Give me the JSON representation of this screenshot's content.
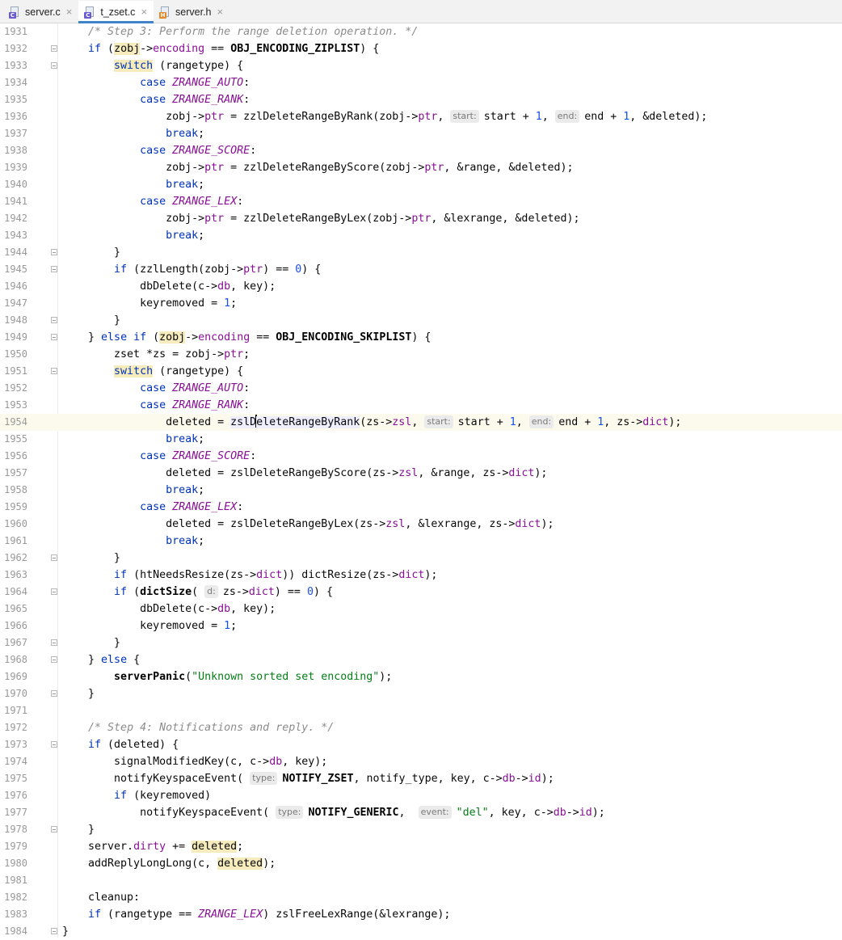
{
  "tabs": [
    {
      "label": "server.c",
      "icon": "c-file-icon",
      "active": false
    },
    {
      "label": "t_zset.c",
      "icon": "c-file-icon",
      "active": true
    },
    {
      "label": "server.h",
      "icon": "header-file-icon",
      "active": false
    }
  ],
  "editor": {
    "current_line": 1954,
    "lines": [
      {
        "n": "1931",
        "fold": false,
        "tokens": [
          [
            "    "
          ],
          [
            "/* Step 3: Perform the range deletion operation. */",
            "cmt"
          ]
        ]
      },
      {
        "n": "1932",
        "fold": true,
        "tokens": [
          [
            "    "
          ],
          [
            "if",
            "kw"
          ],
          [
            " ("
          ],
          [
            "zobj",
            "hl"
          ],
          [
            "->"
          ],
          [
            "encoding",
            "fld"
          ],
          [
            " == "
          ],
          [
            "OBJ_ENCODING_ZIPLIST",
            "bold"
          ],
          [
            ") {"
          ]
        ]
      },
      {
        "n": "1933",
        "fold": true,
        "tokens": [
          [
            "        "
          ],
          [
            "switch",
            "kw hl"
          ],
          [
            " (rangetype) {"
          ]
        ]
      },
      {
        "n": "1934",
        "fold": false,
        "tokens": [
          [
            "            "
          ],
          [
            "case",
            "kw"
          ],
          [
            " "
          ],
          [
            "ZRANGE_AUTO",
            "mac"
          ],
          [
            ":"
          ]
        ]
      },
      {
        "n": "1935",
        "fold": false,
        "tokens": [
          [
            "            "
          ],
          [
            "case",
            "kw"
          ],
          [
            " "
          ],
          [
            "ZRANGE_RANK",
            "mac"
          ],
          [
            ":"
          ]
        ]
      },
      {
        "n": "1936",
        "fold": false,
        "tokens": [
          [
            "                zobj->"
          ],
          [
            "ptr",
            "fld"
          ],
          [
            " = zzlDeleteRangeByRank(zobj->"
          ],
          [
            "ptr",
            "fld"
          ],
          [
            ", "
          ],
          [
            "start:",
            "hint"
          ],
          [
            "start + "
          ],
          [
            "1",
            "num"
          ],
          [
            ", "
          ],
          [
            "end:",
            "hint"
          ],
          [
            "end + "
          ],
          [
            "1",
            "num"
          ],
          [
            ", &deleted);"
          ]
        ]
      },
      {
        "n": "1937",
        "fold": false,
        "tokens": [
          [
            "                "
          ],
          [
            "break",
            "kw"
          ],
          [
            ";"
          ]
        ]
      },
      {
        "n": "1938",
        "fold": false,
        "tokens": [
          [
            "            "
          ],
          [
            "case",
            "kw"
          ],
          [
            " "
          ],
          [
            "ZRANGE_SCORE",
            "mac"
          ],
          [
            ":"
          ]
        ]
      },
      {
        "n": "1939",
        "fold": false,
        "tokens": [
          [
            "                zobj->"
          ],
          [
            "ptr",
            "fld"
          ],
          [
            " = zzlDeleteRangeByScore(zobj->"
          ],
          [
            "ptr",
            "fld"
          ],
          [
            ", &range, &deleted);"
          ]
        ]
      },
      {
        "n": "1940",
        "fold": false,
        "tokens": [
          [
            "                "
          ],
          [
            "break",
            "kw"
          ],
          [
            ";"
          ]
        ]
      },
      {
        "n": "1941",
        "fold": false,
        "tokens": [
          [
            "            "
          ],
          [
            "case",
            "kw"
          ],
          [
            " "
          ],
          [
            "ZRANGE_LEX",
            "mac"
          ],
          [
            ":"
          ]
        ]
      },
      {
        "n": "1942",
        "fold": false,
        "tokens": [
          [
            "                zobj->"
          ],
          [
            "ptr",
            "fld"
          ],
          [
            " = zzlDeleteRangeByLex(zobj->"
          ],
          [
            "ptr",
            "fld"
          ],
          [
            ", &lexrange, &deleted);"
          ]
        ]
      },
      {
        "n": "1943",
        "fold": false,
        "tokens": [
          [
            "                "
          ],
          [
            "break",
            "kw"
          ],
          [
            ";"
          ]
        ]
      },
      {
        "n": "1944",
        "fold": true,
        "tokens": [
          [
            "        }"
          ]
        ]
      },
      {
        "n": "1945",
        "fold": true,
        "tokens": [
          [
            "        "
          ],
          [
            "if",
            "kw"
          ],
          [
            " (zzlLength(zobj->"
          ],
          [
            "ptr",
            "fld"
          ],
          [
            ") == "
          ],
          [
            "0",
            "num"
          ],
          [
            ") {"
          ]
        ]
      },
      {
        "n": "1946",
        "fold": false,
        "tokens": [
          [
            "            dbDelete(c->"
          ],
          [
            "db",
            "fld"
          ],
          [
            ", key);"
          ]
        ]
      },
      {
        "n": "1947",
        "fold": false,
        "tokens": [
          [
            "            keyremoved = "
          ],
          [
            "1",
            "num"
          ],
          [
            ";"
          ]
        ]
      },
      {
        "n": "1948",
        "fold": true,
        "tokens": [
          [
            "        }"
          ]
        ]
      },
      {
        "n": "1949",
        "fold": true,
        "tokens": [
          [
            "    } "
          ],
          [
            "else if",
            "kw"
          ],
          [
            " ("
          ],
          [
            "zobj",
            "hl"
          ],
          [
            "->"
          ],
          [
            "encoding",
            "fld"
          ],
          [
            " == "
          ],
          [
            "OBJ_ENCODING_SKIPLIST",
            "bold"
          ],
          [
            ") {"
          ]
        ]
      },
      {
        "n": "1950",
        "fold": false,
        "tokens": [
          [
            "        zset *zs = zobj->"
          ],
          [
            "ptr",
            "fld"
          ],
          [
            ";"
          ]
        ]
      },
      {
        "n": "1951",
        "fold": true,
        "tokens": [
          [
            "        "
          ],
          [
            "switch",
            "kw hl"
          ],
          [
            " (rangetype) {"
          ]
        ]
      },
      {
        "n": "1952",
        "fold": false,
        "tokens": [
          [
            "            "
          ],
          [
            "case",
            "kw"
          ],
          [
            " "
          ],
          [
            "ZRANGE_AUTO",
            "mac"
          ],
          [
            ":"
          ]
        ]
      },
      {
        "n": "1953",
        "fold": false,
        "tokens": [
          [
            "            "
          ],
          [
            "case",
            "kw"
          ],
          [
            " "
          ],
          [
            "ZRANGE_RANK",
            "mac"
          ],
          [
            ":"
          ]
        ]
      },
      {
        "n": "1954",
        "fold": false,
        "tokens": [
          [
            "                deleted = "
          ],
          [
            "zslD",
            "hl2"
          ],
          [
            "|",
            "caret"
          ],
          [
            "eleteRangeByRank",
            "hl2"
          ],
          [
            "(zs->"
          ],
          [
            "zsl",
            "fld"
          ],
          [
            ", "
          ],
          [
            "start:",
            "hint"
          ],
          [
            "start + "
          ],
          [
            "1",
            "num"
          ],
          [
            ", "
          ],
          [
            "end:",
            "hint"
          ],
          [
            "end + "
          ],
          [
            "1",
            "num"
          ],
          [
            ", zs->"
          ],
          [
            "dict",
            "fld"
          ],
          [
            ");"
          ]
        ]
      },
      {
        "n": "1955",
        "fold": false,
        "tokens": [
          [
            "                "
          ],
          [
            "break",
            "kw"
          ],
          [
            ";"
          ]
        ]
      },
      {
        "n": "1956",
        "fold": false,
        "tokens": [
          [
            "            "
          ],
          [
            "case",
            "kw"
          ],
          [
            " "
          ],
          [
            "ZRANGE_SCORE",
            "mac"
          ],
          [
            ":"
          ]
        ]
      },
      {
        "n": "1957",
        "fold": false,
        "tokens": [
          [
            "                deleted = zslDeleteRangeByScore(zs->"
          ],
          [
            "zsl",
            "fld"
          ],
          [
            ", &range, zs->"
          ],
          [
            "dict",
            "fld"
          ],
          [
            ");"
          ]
        ]
      },
      {
        "n": "1958",
        "fold": false,
        "tokens": [
          [
            "                "
          ],
          [
            "break",
            "kw"
          ],
          [
            ";"
          ]
        ]
      },
      {
        "n": "1959",
        "fold": false,
        "tokens": [
          [
            "            "
          ],
          [
            "case",
            "kw"
          ],
          [
            " "
          ],
          [
            "ZRANGE_LEX",
            "mac"
          ],
          [
            ":"
          ]
        ]
      },
      {
        "n": "1960",
        "fold": false,
        "tokens": [
          [
            "                deleted = zslDeleteRangeByLex(zs->"
          ],
          [
            "zsl",
            "fld"
          ],
          [
            ", &lexrange, zs->"
          ],
          [
            "dict",
            "fld"
          ],
          [
            ");"
          ]
        ]
      },
      {
        "n": "1961",
        "fold": false,
        "tokens": [
          [
            "                "
          ],
          [
            "break",
            "kw"
          ],
          [
            ";"
          ]
        ]
      },
      {
        "n": "1962",
        "fold": true,
        "tokens": [
          [
            "        }"
          ]
        ]
      },
      {
        "n": "1963",
        "fold": false,
        "tokens": [
          [
            "        "
          ],
          [
            "if",
            "kw"
          ],
          [
            " (htNeedsResize(zs->"
          ],
          [
            "dict",
            "fld"
          ],
          [
            ")) dictResize(zs->"
          ],
          [
            "dict",
            "fld"
          ],
          [
            ");"
          ]
        ]
      },
      {
        "n": "1964",
        "fold": true,
        "tokens": [
          [
            "        "
          ],
          [
            "if",
            "kw"
          ],
          [
            " ("
          ],
          [
            "dictSize",
            "bold"
          ],
          [
            "( "
          ],
          [
            "d:",
            "hint"
          ],
          [
            "zs->"
          ],
          [
            "dict",
            "fld"
          ],
          [
            ") == "
          ],
          [
            "0",
            "num"
          ],
          [
            ") {"
          ]
        ]
      },
      {
        "n": "1965",
        "fold": false,
        "tokens": [
          [
            "            dbDelete(c->"
          ],
          [
            "db",
            "fld"
          ],
          [
            ", key);"
          ]
        ]
      },
      {
        "n": "1966",
        "fold": false,
        "tokens": [
          [
            "            keyremoved = "
          ],
          [
            "1",
            "num"
          ],
          [
            ";"
          ]
        ]
      },
      {
        "n": "1967",
        "fold": true,
        "tokens": [
          [
            "        }"
          ]
        ]
      },
      {
        "n": "1968",
        "fold": true,
        "tokens": [
          [
            "    } "
          ],
          [
            "else",
            "kw"
          ],
          [
            " {"
          ]
        ]
      },
      {
        "n": "1969",
        "fold": false,
        "tokens": [
          [
            "        "
          ],
          [
            "serverPanic",
            "bold"
          ],
          [
            "("
          ],
          [
            "\"Unknown sorted set encoding\"",
            "str"
          ],
          [
            ");"
          ]
        ]
      },
      {
        "n": "1970",
        "fold": true,
        "tokens": [
          [
            "    }"
          ]
        ]
      },
      {
        "n": "1971",
        "fold": false,
        "tokens": [
          [
            ""
          ]
        ]
      },
      {
        "n": "1972",
        "fold": false,
        "tokens": [
          [
            "    "
          ],
          [
            "/* Step 4: Notifications and reply. */",
            "cmt"
          ]
        ]
      },
      {
        "n": "1973",
        "fold": true,
        "tokens": [
          [
            "    "
          ],
          [
            "if",
            "kw"
          ],
          [
            " (deleted) {"
          ]
        ]
      },
      {
        "n": "1974",
        "fold": false,
        "tokens": [
          [
            "        signalModifiedKey(c, c->"
          ],
          [
            "db",
            "fld"
          ],
          [
            ", key);"
          ]
        ]
      },
      {
        "n": "1975",
        "fold": false,
        "tokens": [
          [
            "        notifyKeyspaceEvent( "
          ],
          [
            "type:",
            "hint"
          ],
          [
            "NOTIFY_ZSET",
            "bold"
          ],
          [
            ", notify_type, key, c->"
          ],
          [
            "db",
            "fld"
          ],
          [
            "->"
          ],
          [
            "id",
            "fld"
          ],
          [
            ");"
          ]
        ]
      },
      {
        "n": "1976",
        "fold": false,
        "tokens": [
          [
            "        "
          ],
          [
            "if",
            "kw"
          ],
          [
            " (keyremoved)"
          ]
        ]
      },
      {
        "n": "1977",
        "fold": false,
        "tokens": [
          [
            "            notifyKeyspaceEvent( "
          ],
          [
            "type:",
            "hint"
          ],
          [
            "NOTIFY_GENERIC",
            "bold"
          ],
          [
            ",  "
          ],
          [
            "event:",
            "hint"
          ],
          [
            "\"del\"",
            "str"
          ],
          [
            ", key, c->"
          ],
          [
            "db",
            "fld"
          ],
          [
            "->"
          ],
          [
            "id",
            "fld"
          ],
          [
            ");"
          ]
        ]
      },
      {
        "n": "1978",
        "fold": true,
        "tokens": [
          [
            "    }"
          ]
        ]
      },
      {
        "n": "1979",
        "fold": false,
        "tokens": [
          [
            "    server."
          ],
          [
            "dirty",
            "fld"
          ],
          [
            " += "
          ],
          [
            "deleted",
            "hl"
          ],
          [
            ";"
          ]
        ]
      },
      {
        "n": "1980",
        "fold": false,
        "tokens": [
          [
            "    addReplyLongLong(c, "
          ],
          [
            "deleted",
            "hl"
          ],
          [
            ");"
          ]
        ]
      },
      {
        "n": "1981",
        "fold": false,
        "tokens": [
          [
            ""
          ]
        ]
      },
      {
        "n": "1982",
        "fold": false,
        "tokens": [
          [
            "    cleanup:"
          ]
        ]
      },
      {
        "n": "1983",
        "fold": false,
        "tokens": [
          [
            "    "
          ],
          [
            "if",
            "kw"
          ],
          [
            " (rangetype == "
          ],
          [
            "ZRANGE_LEX",
            "mac"
          ],
          [
            ") zslFreeLexRange(&lexrange);"
          ]
        ]
      },
      {
        "n": "1984",
        "fold": true,
        "tokens": [
          [
            "}"
          ]
        ]
      }
    ]
  }
}
